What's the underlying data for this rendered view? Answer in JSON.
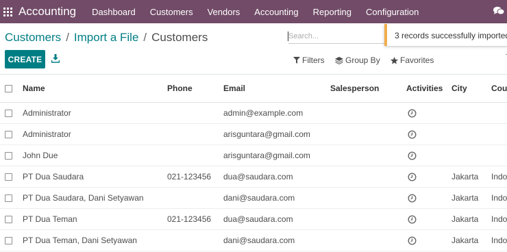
{
  "navbar": {
    "app_name": "Accounting",
    "menu": [
      "Dashboard",
      "Customers",
      "Vendors",
      "Accounting",
      "Reporting",
      "Configuration"
    ]
  },
  "breadcrumb": {
    "items": [
      "Customers",
      "Import a File",
      "Customers"
    ],
    "separator": "/"
  },
  "search": {
    "placeholder": "Search..."
  },
  "notification": {
    "text": "3 records successfully imported"
  },
  "toolbar": {
    "create_label": "CREATE",
    "filters_label": "Filters",
    "groupby_label": "Group By",
    "favorites_label": "Favorites"
  },
  "table": {
    "columns": [
      "Name",
      "Phone",
      "Email",
      "Salesperson",
      "Activities",
      "City",
      "Country"
    ],
    "rows": [
      {
        "name": "Administrator",
        "phone": "",
        "email": "admin@example.com",
        "salesperson": "",
        "city": "",
        "country": ""
      },
      {
        "name": "Administrator",
        "phone": "",
        "email": "arisguntara@gmail.com",
        "salesperson": "",
        "city": "",
        "country": ""
      },
      {
        "name": "John Due",
        "phone": "",
        "email": "arisguntara@gmail.com",
        "salesperson": "",
        "city": "",
        "country": ""
      },
      {
        "name": "PT Dua Saudara",
        "phone": "021-123456",
        "email": "dua@saudara.com",
        "salesperson": "",
        "city": "Jakarta",
        "country": "Indonesia"
      },
      {
        "name": "PT Dua Saudara, Dani Setyawan",
        "phone": "",
        "email": "dani@saudara.com",
        "salesperson": "",
        "city": "Jakarta",
        "country": "Indonesia"
      },
      {
        "name": "PT Dua Teman",
        "phone": "021-123456",
        "email": "dua@saudara.com",
        "salesperson": "",
        "city": "Jakarta",
        "country": "Indonesia"
      },
      {
        "name": "PT Dua Teman, Dani Setyawan",
        "phone": "",
        "email": "dani@saudara.com",
        "salesperson": "",
        "city": "Jakarta",
        "country": "Indonesia"
      }
    ]
  },
  "colors": {
    "navbar": "#714b67",
    "primary": "#017e84",
    "toast_accent": "#f0ad4e"
  }
}
